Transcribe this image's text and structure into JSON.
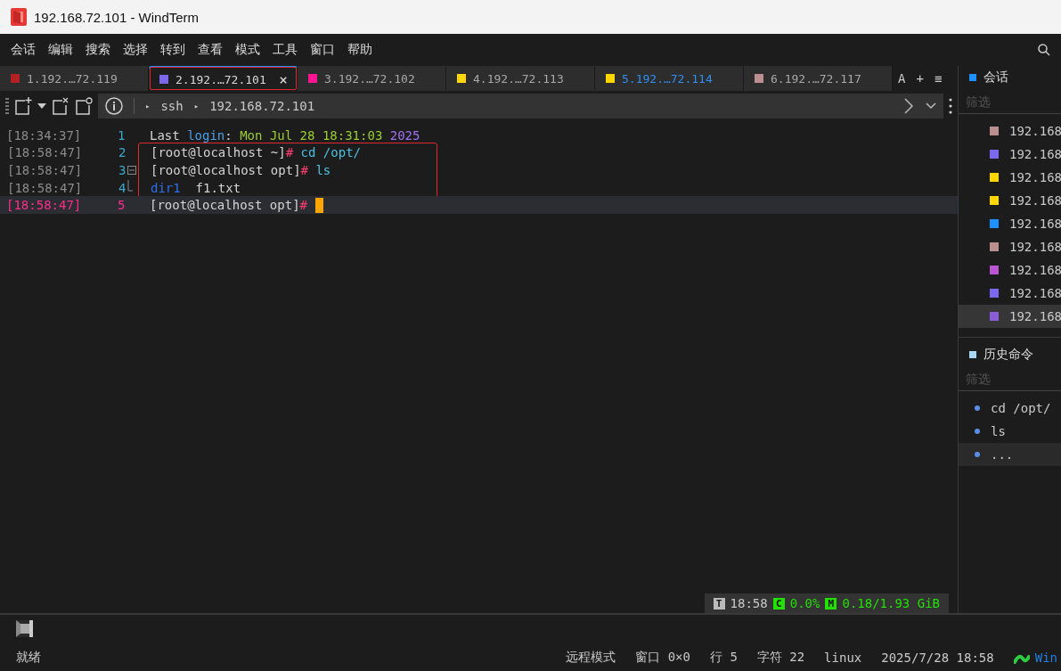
{
  "window": {
    "title": "192.168.72.101 - WindTerm"
  },
  "menu": [
    "会话",
    "编辑",
    "搜索",
    "选择",
    "转到",
    "查看",
    "模式",
    "工具",
    "窗口",
    "帮助"
  ],
  "tabs": [
    {
      "label": "1.192.…72.119",
      "color": "#b22222",
      "selected": false,
      "accented": false,
      "highlighted": false
    },
    {
      "label": "2.192.…72.101",
      "color": "#7b68ee",
      "selected": true,
      "accented": false,
      "highlighted": true,
      "close": "×"
    },
    {
      "label": "3.192.…72.102",
      "color": "#ff1493",
      "selected": false,
      "accented": false,
      "highlighted": false
    },
    {
      "label": "4.192.…72.113",
      "color": "#ffd700",
      "selected": false,
      "accented": false,
      "highlighted": false
    },
    {
      "label": "5.192.…72.114",
      "color": "#ffd700",
      "selected": false,
      "accented": true,
      "highlighted": false
    },
    {
      "label": "6.192.…72.117",
      "color": "#bc8f8f",
      "selected": false,
      "accented": false,
      "highlighted": false
    }
  ],
  "tab_actions": [
    "A",
    "+",
    "≡"
  ],
  "breadcrumb": [
    {
      "marker": "▸",
      "label": "ssh"
    },
    {
      "marker": "▸",
      "label": "192.168.72.101"
    }
  ],
  "terminal": {
    "lines": [
      {
        "time": "[18:34:37]",
        "number": "1",
        "current": false,
        "boxed": false,
        "fold_start": false,
        "fold_end": false,
        "segments": [
          {
            "text": "Last ",
            "kind": "plain"
          },
          {
            "text": "login",
            "kind": "keyword"
          },
          {
            "text": ": ",
            "kind": "plain"
          },
          {
            "text": "Mon Jul 28 18:31:03 ",
            "kind": "date"
          },
          {
            "text": "2025",
            "kind": "number"
          }
        ]
      },
      {
        "time": "[18:58:47]",
        "number": "2",
        "current": false,
        "boxed": true,
        "fold_start": false,
        "fold_end": false,
        "segments": [
          {
            "text": "[root@localhost ~]",
            "kind": "plain"
          },
          {
            "text": "#",
            "kind": "sign"
          },
          {
            "text": " cd /opt/",
            "kind": "command"
          }
        ]
      },
      {
        "time": "[18:58:47]",
        "number": "3",
        "current": false,
        "boxed": true,
        "fold_start": true,
        "fold_end": false,
        "segments": [
          {
            "text": "[root@localhost opt]",
            "kind": "plain"
          },
          {
            "text": "#",
            "kind": "sign"
          },
          {
            "text": " ls",
            "kind": "command"
          }
        ]
      },
      {
        "time": "[18:58:47]",
        "number": "4",
        "current": false,
        "boxed": true,
        "fold_start": false,
        "fold_end": true,
        "segments": [
          {
            "text": "dir1",
            "kind": "dir"
          },
          {
            "text": "  f1.txt",
            "kind": "plain"
          }
        ]
      },
      {
        "time": "[18:58:47]",
        "number": "5",
        "current": true,
        "boxed": false,
        "fold_start": false,
        "fold_end": false,
        "cursor": true,
        "segments": [
          {
            "text": "[root@localhost opt]",
            "kind": "plain"
          },
          {
            "text": "#",
            "kind": "sign"
          }
        ]
      }
    ],
    "status": [
      {
        "badge": "T",
        "value": "18:58",
        "kind": "time"
      },
      {
        "badge": "C",
        "value": "0.0%",
        "kind": "meter"
      },
      {
        "badge": "M",
        "value": "0.18/1.93 GiB",
        "kind": "meter"
      }
    ]
  },
  "sessions": {
    "title": "会话",
    "placeholder": "筛选",
    "items": [
      {
        "label": "192.168",
        "color": "#bc8f8f",
        "selected": false
      },
      {
        "label": "192.168",
        "color": "#7b68ee",
        "selected": false
      },
      {
        "label": "192.168",
        "color": "#ffd700",
        "selected": false
      },
      {
        "label": "192.168",
        "color": "#ffd700",
        "selected": false
      },
      {
        "label": "192.168",
        "color": "#1e90ff",
        "selected": false
      },
      {
        "label": "192.168",
        "color": "#bc8f8f",
        "selected": false
      },
      {
        "label": "192.168",
        "color": "#ba55d3",
        "selected": false
      },
      {
        "label": "192.168",
        "color": "#7b68ee",
        "selected": false
      },
      {
        "label": "192.168",
        "color": "#8a5cd6",
        "selected": true
      }
    ]
  },
  "history": {
    "title": "历史命令",
    "placeholder": "筛选",
    "items": [
      {
        "label": "cd /opt/",
        "selected": false
      },
      {
        "label": "ls",
        "selected": false
      },
      {
        "label": "...",
        "selected": true
      }
    ]
  },
  "status_bar": {
    "message": "就绪",
    "items": [
      "远程模式",
      "窗口 0×0",
      "行 5",
      "字符 22",
      "linux",
      "2025/7/28 18:58"
    ],
    "brand": "Win"
  }
}
